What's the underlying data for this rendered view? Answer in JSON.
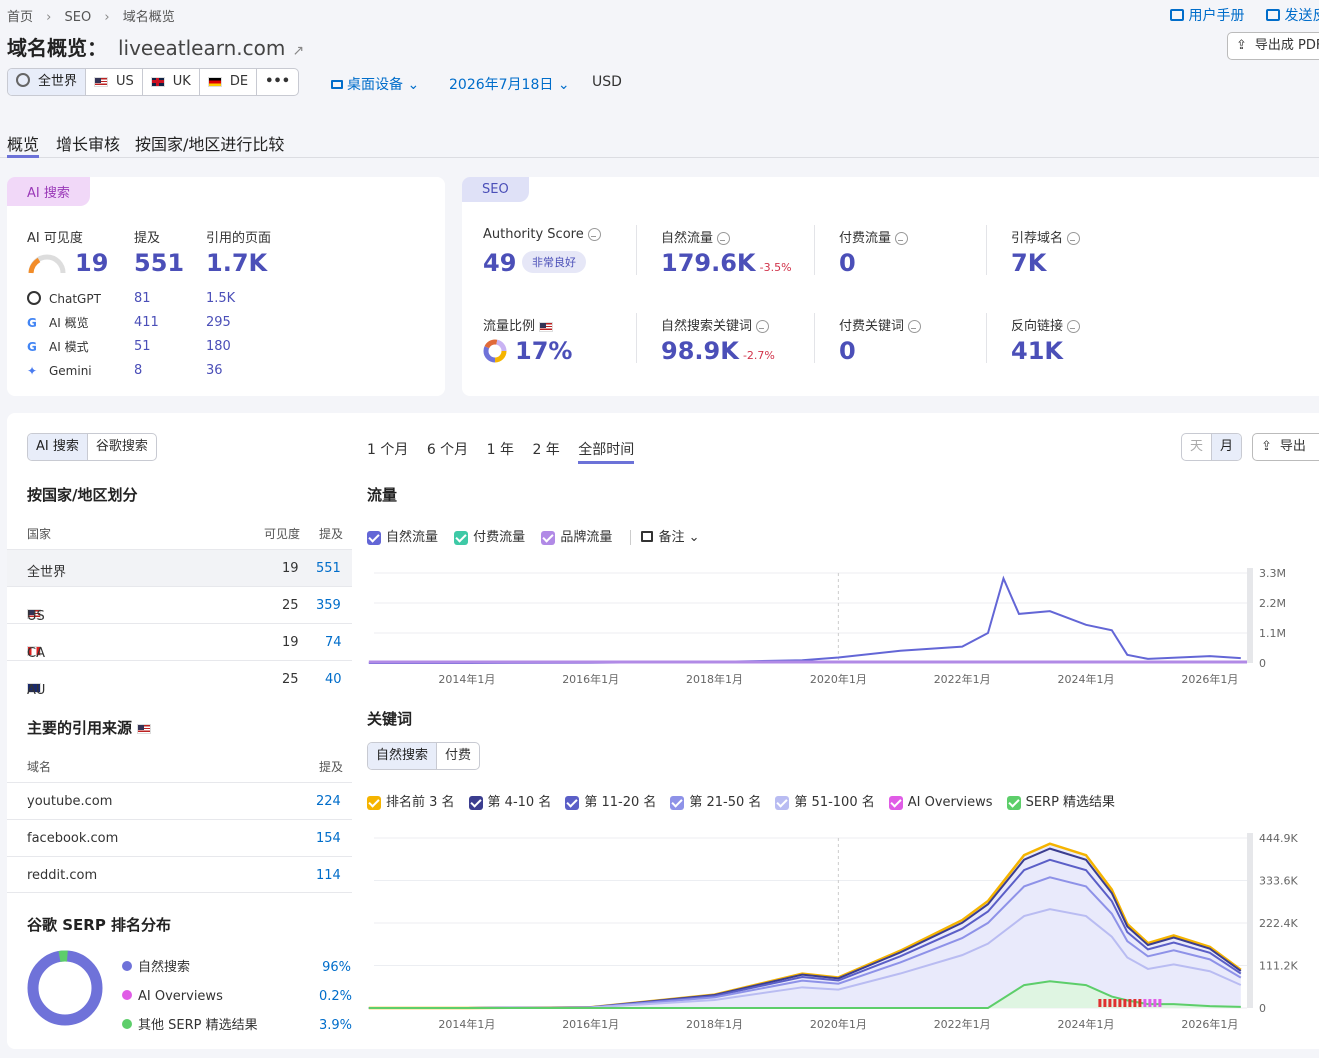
{
  "breadcrumb": [
    "首页",
    "SEO",
    "域名概览"
  ],
  "top_links": {
    "manual": "用户手册",
    "feedback": "发送反馈",
    "export_pdf": "导出成 PDF"
  },
  "page_title": "域名概览：",
  "domain": "liveeatlearn.com",
  "regions": [
    "全世界",
    "US",
    "UK",
    "DE",
    "•••"
  ],
  "device": "桌面设备",
  "date": "2026年7月18日",
  "currency": "USD",
  "main_tabs": [
    "概览",
    "增长审核",
    "按国家/地区进行比较"
  ],
  "ai_card": {
    "badge": "AI 搜索",
    "cols": [
      "AI 可见度",
      "提及",
      "引用的页面"
    ],
    "visibility": "19",
    "mentions": "551",
    "cited": "1.7K",
    "rows": [
      {
        "name": "ChatGPT",
        "m": "81",
        "c": "1.5K"
      },
      {
        "name": "AI 概览",
        "m": "411",
        "c": "295"
      },
      {
        "name": "AI 模式",
        "m": "51",
        "c": "180"
      },
      {
        "name": "Gemini",
        "m": "8",
        "c": "36"
      }
    ]
  },
  "seo_card": {
    "badge": "SEO",
    "m1": {
      "label": "Authority Score",
      "value": "49",
      "tag": "非常良好"
    },
    "m2": {
      "label": "自然流量",
      "value": "179.6K",
      "delta": "-3.5%"
    },
    "m3": {
      "label": "付费流量",
      "value": "0"
    },
    "m4": {
      "label": "引荐域名",
      "value": "7K"
    },
    "m5": {
      "label": "流量比例",
      "value": "17%"
    },
    "m6": {
      "label": "自然搜索关键词",
      "value": "98.9K",
      "delta": "-2.7%"
    },
    "m7": {
      "label": "付费关键词",
      "value": "0"
    },
    "m8": {
      "label": "反向链接",
      "value": "41K"
    }
  },
  "left_panel": {
    "toggle": [
      "AI 搜索",
      "谷歌搜索"
    ],
    "country_title": "按国家/地区划分",
    "country_cols": [
      "国家",
      "可见度",
      "提及"
    ],
    "countries": [
      {
        "name": "全世界",
        "v": "19",
        "m": "551"
      },
      {
        "name": "US",
        "v": "25",
        "m": "359"
      },
      {
        "name": "CA",
        "v": "19",
        "m": "74"
      },
      {
        "name": "AU",
        "v": "25",
        "m": "40"
      }
    ],
    "sources_title": "主要的引用来源",
    "source_cols": [
      "域名",
      "提及"
    ],
    "sources": [
      {
        "d": "youtube.com",
        "m": "224"
      },
      {
        "d": "facebook.com",
        "m": "154"
      },
      {
        "d": "reddit.com",
        "m": "114"
      }
    ],
    "serp_title": "谷歌 SERP 排名分布",
    "serp": [
      {
        "name": "自然搜索",
        "pct": "96%",
        "color": "#6f72d9"
      },
      {
        "name": "AI Overviews",
        "pct": "0.2%",
        "color": "#e05ce6"
      },
      {
        "name": "其他 SERP 精选结果",
        "pct": "3.9%",
        "color": "#5dce6a"
      }
    ]
  },
  "range_tabs": [
    "1 个月",
    "6 个月",
    "1 年",
    "2 年",
    "全部时间"
  ],
  "granularity": [
    "天",
    "月"
  ],
  "export": "导出",
  "traffic": {
    "title": "流量",
    "legend": [
      {
        "name": "自然流量",
        "color": "#6366d6"
      },
      {
        "name": "付费流量",
        "color": "#3ec9a6"
      },
      {
        "name": "品牌流量",
        "color": "#b18ae6"
      }
    ],
    "notes": "备注"
  },
  "keywords": {
    "title": "关键词",
    "toggle": [
      "自然搜索",
      "付费"
    ],
    "legend": [
      {
        "name": "排名前 3 名",
        "color": "#f5b400"
      },
      {
        "name": "第 4-10 名",
        "color": "#3b3d8f"
      },
      {
        "name": "第 11-20 名",
        "color": "#5b5fc7"
      },
      {
        "name": "第 21-50 名",
        "color": "#8e92e8"
      },
      {
        "name": "第 51-100 名",
        "color": "#b9bcf2"
      },
      {
        "name": "AI Overviews",
        "color": "#e05ce6"
      },
      {
        "name": "SERP 精选结果",
        "color": "#5dce6a"
      }
    ]
  },
  "chart_data": [
    {
      "type": "line",
      "title": "流量",
      "x": [
        "2012-06",
        "2014-01",
        "2016-01",
        "2018-01",
        "2019-06",
        "2020-01",
        "2021-01",
        "2022-01",
        "2022-06",
        "2022-09",
        "2022-12",
        "2023-06",
        "2024-01",
        "2024-06",
        "2024-09",
        "2025-01",
        "2026-01",
        "2026-07"
      ],
      "series": [
        {
          "name": "自然流量",
          "values": [
            0,
            0,
            10000,
            40000,
            100000,
            200000,
            450000,
            600000,
            1100000,
            3100000,
            1800000,
            1900000,
            1400000,
            1200000,
            300000,
            150000,
            250000,
            180000
          ]
        },
        {
          "name": "付费流量",
          "values": [
            0,
            0,
            0,
            0,
            0,
            0,
            0,
            0,
            0,
            0,
            0,
            0,
            0,
            0,
            0,
            0,
            0,
            0
          ]
        },
        {
          "name": "品牌流量",
          "values": [
            0,
            0,
            0,
            0,
            0,
            0,
            0,
            0,
            0,
            0,
            0,
            0,
            0,
            0,
            0,
            0,
            0,
            0
          ]
        }
      ],
      "yticks": [
        "0",
        "1.1M",
        "2.2M",
        "3.3M"
      ],
      "xticks": [
        "2014年1月",
        "2016年1月",
        "2018年1月",
        "2020年1月",
        "2022年1月",
        "2024年1月",
        "2026年1月"
      ],
      "ylim": [
        0,
        3300000
      ]
    },
    {
      "type": "area",
      "title": "关键词",
      "x": [
        "2012-06",
        "2014-01",
        "2016-01",
        "2018-01",
        "2019-06",
        "2020-01",
        "2021-01",
        "2022-01",
        "2022-06",
        "2023-01",
        "2023-06",
        "2024-01",
        "2024-06",
        "2024-09",
        "2025-01",
        "2025-06",
        "2026-01",
        "2026-07"
      ],
      "series": [
        {
          "name": "排名前 3 名",
          "values": [
            0,
            0,
            2000,
            35000,
            90000,
            80000,
            150000,
            230000,
            280000,
            400000,
            430000,
            400000,
            310000,
            220000,
            170000,
            190000,
            160000,
            100000
          ]
        },
        {
          "name": "SERP 精选结果",
          "values": [
            0,
            0,
            0,
            0,
            0,
            0,
            0,
            0,
            0,
            60000,
            70000,
            60000,
            30000,
            20000,
            10000,
            10000,
            5000,
            3000
          ]
        }
      ],
      "yticks": [
        "0",
        "111.2K",
        "222.4K",
        "333.6K",
        "444.9K"
      ],
      "xticks": [
        "2014年1月",
        "2016年1月",
        "2018年1月",
        "2020年1月",
        "2022年1月",
        "2024年1月",
        "2026年1月"
      ],
      "ylim": [
        0,
        444900
      ]
    }
  ]
}
